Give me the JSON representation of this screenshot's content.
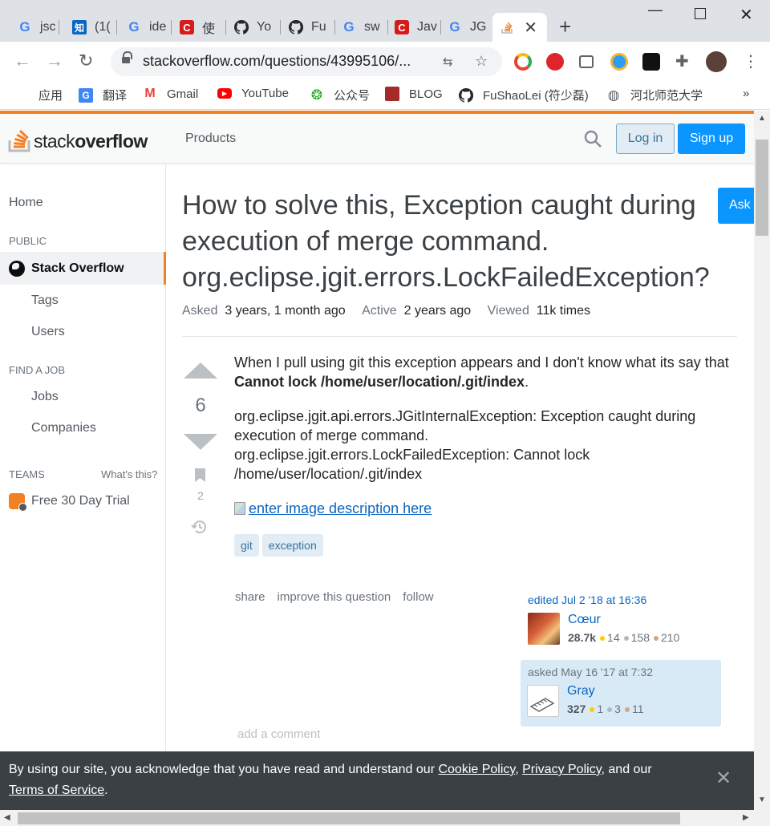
{
  "browser": {
    "tabs": [
      {
        "favicon": "google-icon",
        "title": "jsc"
      },
      {
        "favicon": "zhihu-icon",
        "title": "(1("
      },
      {
        "favicon": "google-icon",
        "title": "ide"
      },
      {
        "favicon": "csdn-icon",
        "title": "使"
      },
      {
        "favicon": "github-icon",
        "title": "Yo"
      },
      {
        "favicon": "github-icon",
        "title": "Fu"
      },
      {
        "favicon": "google-icon",
        "title": "sw"
      },
      {
        "favicon": "csdn-icon",
        "title": "Jav"
      },
      {
        "favicon": "google-icon",
        "title": "JG"
      },
      {
        "favicon": "stackoverflow-icon",
        "title": ""
      }
    ],
    "url": "stackoverflow.com/questions/43995106/...",
    "bookmarks": [
      {
        "icon": "apps-grid-icon",
        "label": "应用"
      },
      {
        "icon": "google-translate-icon",
        "label": "翻译"
      },
      {
        "icon": "gmail-icon",
        "label": "Gmail"
      },
      {
        "icon": "youtube-icon",
        "label": "YouTube"
      },
      {
        "icon": "wechat-icon",
        "label": "公众号"
      },
      {
        "icon": "blog-icon",
        "label": "BLOG"
      },
      {
        "icon": "github-icon",
        "label": "FuShaoLei (符少磊)"
      },
      {
        "icon": "globe-icon",
        "label": "河北师范大学"
      }
    ],
    "bookmarks_more": "»"
  },
  "header": {
    "logo_stack": "stack",
    "logo_overflow": "overflow",
    "products": "Products",
    "login": "Log in",
    "signup": "Sign up"
  },
  "sidebar": {
    "home": "Home",
    "public": "PUBLIC",
    "stackoverflow": "Stack Overflow",
    "tags": "Tags",
    "users": "Users",
    "find_a_job": "FIND A JOB",
    "jobs": "Jobs",
    "companies": "Companies",
    "teams": "TEAMS",
    "whats_this": "What's this?",
    "free_trial": "Free 30 Day Trial"
  },
  "question": {
    "title": "How to solve this, Exception caught during execution of merge command. org.eclipse.jgit.errors.LockFailedException?",
    "ask_button": "Ask",
    "asked_label": "Asked",
    "asked_value": "3 years, 1 month ago",
    "active_label": "Active",
    "active_value": "2 years ago",
    "viewed_label": "Viewed",
    "viewed_value": "11k times",
    "votes": "6",
    "bookmarks": "2",
    "body_intro": "When I pull using git this exception appears and I don't know what its say that ",
    "body_bold": "Cannot lock /home/user/location/.git/index",
    "body_end": ".",
    "error_line1": "org.eclipse.jgit.api.errors.JGitInternalException: Exception caught during execution of merge command.",
    "error_line2": "org.eclipse.jgit.errors.LockFailedException: Cannot lock /home/user/location/.git/index",
    "image_alt": "enter image description here",
    "tags": [
      "git",
      "exception"
    ],
    "menu": [
      "share",
      "improve this question",
      "follow"
    ],
    "edited": {
      "action": "edited Jul 2 '18 at 16:36",
      "name": "Cœur",
      "rep": "28.7k",
      "gold": "14",
      "silver": "158",
      "bronze": "210"
    },
    "asked": {
      "action": "asked May 16 '17 at 7:32",
      "name": "Gray",
      "rep": "327",
      "gold": "1",
      "silver": "3",
      "bronze": "11"
    },
    "add_comment": "add a comment"
  },
  "cookie": {
    "text1": "By using our site, you acknowledge that you have read and understand our ",
    "cookie_policy": "Cookie Policy",
    "comma": ", ",
    "privacy_policy": "Privacy Policy",
    "text2": ", and our ",
    "terms": "Terms of Service",
    "text3": "."
  },
  "colors": {
    "so_orange": "#f48024",
    "so_blue": "#0a95ff",
    "link_blue": "#0a66c2",
    "badge_gold": "#ffcc01",
    "badge_silver": "#b4b8bc",
    "badge_bronze": "#d1a684"
  }
}
